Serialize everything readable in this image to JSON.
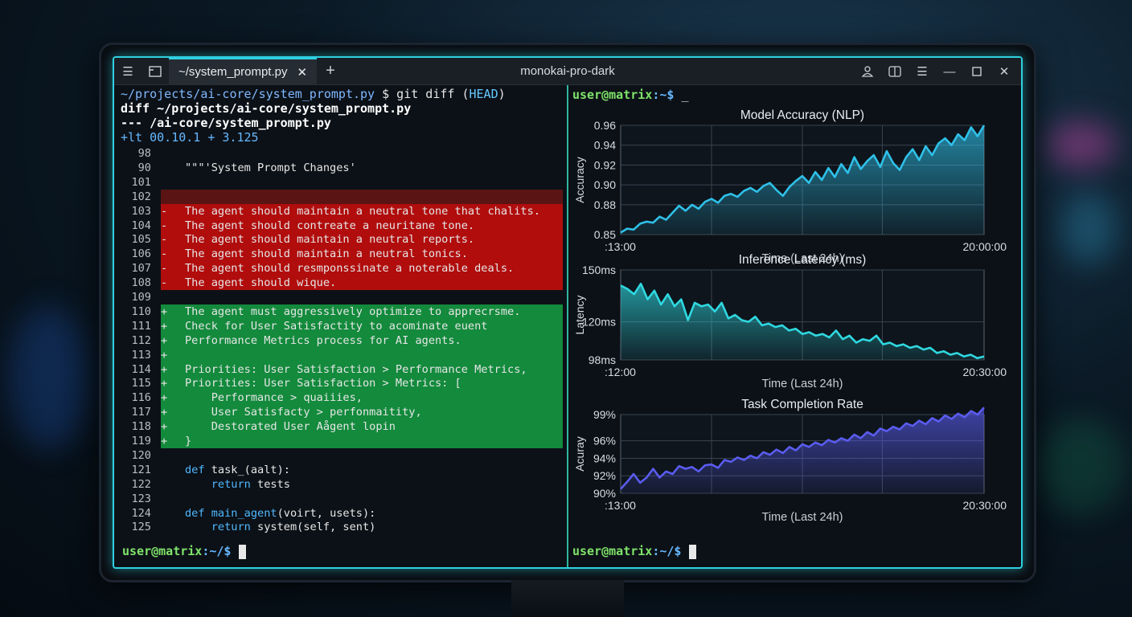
{
  "titlebar": {
    "tab_label": "~/system_prompt.py",
    "window_title": "monokai-pro-dark",
    "menu_icon": "hamburger-icon",
    "newtab_symbol": "+",
    "close_symbol": "✕"
  },
  "left_pane": {
    "command_line_path": "~/projects/ai-core/system_prompt.py",
    "command_line_prompt": " $ ",
    "command_line_cmd": "git diff (",
    "command_line_head": "HEAD",
    "command_line_end": ")",
    "diff_header_1": "diff ~/projects/ai-core/system_prompt.py",
    "diff_header_2": "--- /ai-core/system_prompt.py",
    "diff_header_3": "+lt 00.10.1 + 3.125",
    "lines": [
      {
        "num": "98",
        "sign": "",
        "code": "",
        "type": "ctx"
      },
      {
        "num": "90",
        "sign": "",
        "code": "\"\"\"'System Prompt Changes'",
        "type": "ctx"
      },
      {
        "num": "101",
        "sign": "",
        "code": "",
        "type": "ctx"
      },
      {
        "num": "102",
        "sign": "",
        "code": "",
        "type": "deldark"
      },
      {
        "num": "103",
        "sign": "-",
        "code": "The agent should maintain a neutral tone that chalits.",
        "type": "del"
      },
      {
        "num": "104",
        "sign": "-",
        "code": "The agent should contreate a neuritane tone.",
        "type": "del"
      },
      {
        "num": "105",
        "sign": "-",
        "code": "The agent should maintain a neutral reports.",
        "type": "del"
      },
      {
        "num": "106",
        "sign": "-",
        "code": "The agent should maintain a neutral tonics.",
        "type": "del"
      },
      {
        "num": "107",
        "sign": "-",
        "code": "The agent should resmponssinate a noterable deals.",
        "type": "del"
      },
      {
        "num": "108",
        "sign": "-",
        "code": "The agent should wique.",
        "type": "del"
      },
      {
        "num": "109",
        "sign": "",
        "code": "",
        "type": "ctx"
      },
      {
        "num": "110",
        "sign": "+",
        "code": "The agent must aggressively optimize to apprecrsme.",
        "type": "add"
      },
      {
        "num": "111",
        "sign": "+",
        "code": "Check for User Satisfactity to acominate euent",
        "type": "add"
      },
      {
        "num": "112",
        "sign": "+",
        "code": "Performance Metrics process for AI agents.",
        "type": "add"
      },
      {
        "num": "113",
        "sign": "+",
        "code": "",
        "type": "add"
      },
      {
        "num": "114",
        "sign": "+",
        "code": "Priorities: User Satisfaction > Performance Metrics,",
        "type": "add"
      },
      {
        "num": "115",
        "sign": "+",
        "code": "Priorities: User Satisfaction > Metrics: [",
        "type": "add"
      },
      {
        "num": "116",
        "sign": "+",
        "code": "    Performance > quaiiies,",
        "type": "add"
      },
      {
        "num": "117",
        "sign": "+",
        "code": "    User Satisfacty > perfonmaitity,",
        "type": "add"
      },
      {
        "num": "118",
        "sign": "+",
        "code": "    Destorated User Aågent lopin",
        "type": "add"
      },
      {
        "num": "119",
        "sign": "+",
        "code": "}",
        "type": "add"
      },
      {
        "num": "120",
        "sign": "",
        "code": "",
        "type": "ctx"
      },
      {
        "num": "121",
        "sign": "",
        "kw": "def ",
        "code": "task_(aalt):",
        "type": "ctx"
      },
      {
        "num": "122",
        "sign": "",
        "kw": "    return ",
        "code": "tests",
        "type": "ctx"
      },
      {
        "num": "123",
        "sign": "",
        "code": "",
        "type": "ctx"
      },
      {
        "num": "124",
        "sign": "",
        "kw": "def ",
        "kw2": "main_agent",
        "code": "(voirt, usets):",
        "type": "ctx"
      },
      {
        "num": "125",
        "sign": "",
        "kw": "    return ",
        "code": "system(self, sent)",
        "type": "ctx"
      }
    ],
    "prompt_user": "user@matrix",
    "prompt_path": ":~/$",
    "prompt_sym": " "
  },
  "right_pane": {
    "top_prompt_user": "user@matrix",
    "top_prompt_path": ":~$",
    "top_prompt_cursor": " _",
    "prompt_user": "user@matrix",
    "prompt_path": ":~/$",
    "prompt_sym": " "
  },
  "colors": {
    "accent": "#2fd0e0",
    "del_bg": "#b10d0d",
    "add_bg": "#138a3c",
    "chart1_line": "#2fc0e8",
    "chart2_line": "#2fd8e0",
    "chart3_line": "#5a5cf0"
  },
  "chart_data": [
    {
      "type": "area",
      "title": "Model Accuracy (NLP)",
      "xlabel": "Time (Last 24h)",
      "ylabel": "Accuracy",
      "x_tick_labels": [
        ":13:00",
        "20:00:00"
      ],
      "y_ticks": [
        0.85,
        0.88,
        0.9,
        0.92,
        0.94,
        0.96
      ],
      "y_tick_labels": [
        "0.85",
        "0.88",
        "0.90",
        "0.92",
        "0.94",
        "0.96"
      ],
      "ylim": [
        0.85,
        0.96
      ],
      "grid": true,
      "values": [
        0.852,
        0.856,
        0.855,
        0.861,
        0.863,
        0.862,
        0.868,
        0.865,
        0.872,
        0.879,
        0.874,
        0.88,
        0.876,
        0.883,
        0.886,
        0.882,
        0.889,
        0.891,
        0.888,
        0.894,
        0.897,
        0.893,
        0.899,
        0.902,
        0.895,
        0.889,
        0.898,
        0.904,
        0.909,
        0.902,
        0.913,
        0.905,
        0.917,
        0.908,
        0.921,
        0.912,
        0.928,
        0.916,
        0.924,
        0.93,
        0.918,
        0.934,
        0.922,
        0.915,
        0.928,
        0.936,
        0.925,
        0.939,
        0.93,
        0.942,
        0.947,
        0.94,
        0.951,
        0.945,
        0.958,
        0.949,
        0.96
      ]
    },
    {
      "type": "area",
      "title": "Inference Latency (ms)",
      "xlabel": "Time (Last 24h)",
      "ylabel": "Latency",
      "x_tick_labels": [
        ":12:00",
        "20:30:00"
      ],
      "y_ticks": [
        98,
        120,
        150
      ],
      "y_tick_labels": [
        "98ms",
        "120ms",
        "150ms"
      ],
      "ylim": [
        98,
        150
      ],
      "grid": true,
      "values": [
        141,
        139,
        136,
        142,
        133,
        138,
        130,
        136,
        129,
        133,
        121,
        131,
        129,
        130,
        126,
        131,
        122,
        124,
        121,
        120,
        123,
        118,
        119,
        117,
        118,
        115,
        116,
        113,
        114,
        112,
        113,
        111,
        115,
        110,
        112,
        108,
        110,
        109,
        112,
        107,
        108,
        106,
        107,
        105,
        106,
        104,
        105,
        102,
        103,
        101,
        102,
        100,
        101,
        99,
        100
      ]
    },
    {
      "type": "area",
      "title": "Task Completion Rate",
      "xlabel": "Time (Last 24h)",
      "ylabel": "Acuray",
      "x_tick_labels": [
        ":13:00",
        "20:30:00"
      ],
      "y_ticks": [
        90,
        92,
        94,
        96,
        99
      ],
      "y_tick_labels": [
        "90%",
        "92%",
        "94%",
        "96%",
        "99%"
      ],
      "ylim": [
        90,
        99
      ],
      "grid": true,
      "values": [
        90.5,
        91.3,
        92.2,
        91.2,
        91.8,
        92.8,
        91.8,
        92.5,
        92.2,
        93.1,
        92.8,
        93.0,
        92.5,
        93.2,
        93.3,
        92.9,
        93.8,
        93.6,
        94.1,
        93.8,
        94.3,
        94.0,
        94.7,
        94.4,
        95.0,
        94.6,
        95.3,
        94.9,
        95.6,
        95.3,
        95.8,
        95.5,
        96.1,
        95.8,
        96.3,
        96.0,
        96.7,
        96.3,
        97.0,
        96.6,
        97.4,
        97.1,
        97.6,
        97.3,
        98.0,
        97.7,
        98.3,
        97.9,
        98.6,
        98.2,
        98.9,
        98.5,
        99.1,
        98.7,
        99.4,
        99.0,
        99.8
      ]
    }
  ]
}
